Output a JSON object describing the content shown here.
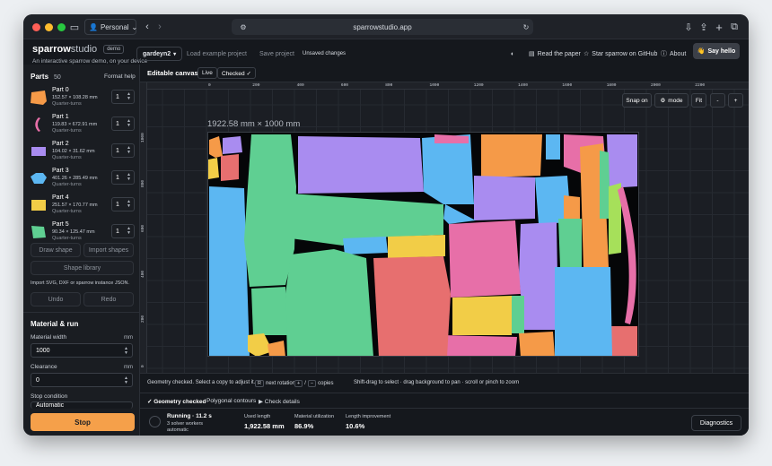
{
  "browser": {
    "profile": "Personal",
    "url": "sparrowstudio.app",
    "colors": {
      "close": "#ff5f57",
      "minimize": "#febc2e",
      "maximize": "#28c840"
    }
  },
  "header": {
    "brand_main": "sparrow",
    "brand_sub": "studio",
    "brand_badge": "demo",
    "tagline": "An interactive sparrow demo, on your device",
    "project_name": "gardeyn2",
    "load_example": "Load example project",
    "save_project": "Save project",
    "unsaved": "Unsaved changes",
    "read_paper": "Read the paper",
    "star": "Star sparrow on GitHub",
    "about": "About",
    "say_hello": "Say hello"
  },
  "sidebar": {
    "parts_title": "Parts",
    "parts_count": "50",
    "format_help": "Format help",
    "parts": [
      {
        "name": "Part 0",
        "dims": "152.57 × 108.28 mm",
        "rotation": "Quarter-turns",
        "qty": "1",
        "color": "#f59a48"
      },
      {
        "name": "Part 1",
        "dims": "119.83 × 672.91 mm",
        "rotation": "Quarter-turns",
        "qty": "1",
        "color": "#e76fa8"
      },
      {
        "name": "Part 2",
        "dims": "104.02 × 31.62 mm",
        "rotation": "Quarter-turns",
        "qty": "1",
        "color": "#a98cf0"
      },
      {
        "name": "Part 3",
        "dims": "401.26 × 285.49 mm",
        "rotation": "Quarter-turns",
        "qty": "1",
        "color": "#5cb7f2"
      },
      {
        "name": "Part 4",
        "dims": "251.57 × 170.77 mm",
        "rotation": "Quarter-turns",
        "qty": "1",
        "color": "#f2cd47"
      },
      {
        "name": "Part 5",
        "dims": "90.34 × 125.47 mm",
        "rotation": "Quarter-turns",
        "qty": "1",
        "color": "#5fcf92"
      }
    ],
    "draw_shape": "Draw shape",
    "import_shapes": "Import shapes",
    "shape_library": "Shape library",
    "import_hint": "Import SVG, DXF or sparrow instance JSON.",
    "undo": "Undo",
    "redo": "Redo",
    "material_title": "Material & run",
    "material_width_label": "Material width",
    "material_width_unit": "mm",
    "material_width": "1000",
    "clearance_label": "Clearance",
    "clearance_unit": "mm",
    "clearance": "0",
    "stop_condition_label": "Stop condition",
    "stop_condition": "Automatic",
    "stop": "Stop"
  },
  "canvas": {
    "title": "Editable canvas",
    "live": "Live",
    "checked": "Checked ✓",
    "snap": "Snap on",
    "mode": "mode",
    "fit": "Fit",
    "minus": "-",
    "plus": "+",
    "dimension_label": "1922.58 mm × 1000 mm",
    "x_ticks": [
      "0",
      "200",
      "400",
      "600",
      "800",
      "1000",
      "1200",
      "1400",
      "1600",
      "1800",
      "2000",
      "2200"
    ],
    "y_ticks": [
      "1000",
      "800",
      "600",
      "400",
      "200",
      "0"
    ]
  },
  "status": {
    "geometry_msg": "Geometry checked. Select a copy to adjust it.",
    "key_rotate": "R",
    "next_rotation": "next rotation",
    "key_plus": "+",
    "key_minus": "−",
    "copies": "copies",
    "shift_hint": "Shift-drag to select · drag background to pan · scroll or pinch to zoom"
  },
  "tabs": {
    "geometry": "✓ Geometry checked",
    "polygonal": "Polygonal contours",
    "check_details": "▶ Check details"
  },
  "footer": {
    "running": "Running · 11.2 s",
    "workers": "3 solver workers",
    "automatic": "automatic",
    "used_length_label": "Used length",
    "used_length": "1,922.58 mm",
    "utilization_label": "Material utilization",
    "utilization": "86.9%",
    "improvement_label": "Length improvement",
    "improvement": "10.6%",
    "diagnostics": "Diagnostics"
  }
}
